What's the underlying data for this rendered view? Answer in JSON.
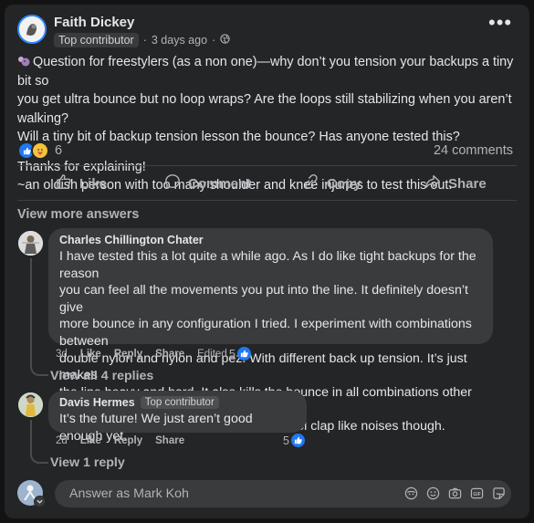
{
  "post": {
    "author": "Faith Dickey",
    "badge": "Top contributor",
    "time": "3 days ago",
    "audience_icon": "globe-icon",
    "menu_label": "•••",
    "body_line1": "Question for freestylers (as a non one)—why don’t you tension your backups a tiny bit so",
    "body_line2": "you get ultra bounce but no loop wraps? Are the loops still stabilizing when you aren’t walking?",
    "body_line3": "Will a tiny bit of backup tension lesson the bounce? Has anyone tested this?",
    "body_line4": "Thanks for explaining!",
    "body_line5": "~an oldish person with too many shoulder and knee injuries to test this out.",
    "reaction_count": "6",
    "comments_count": "24 comments"
  },
  "actions": {
    "like": "Like",
    "comment": "Comment",
    "copy": "Copy",
    "share": "Share"
  },
  "view_more_answers": "View more answers",
  "comments": [
    {
      "author": "Charles Chillington Chater",
      "lines": [
        "I have tested this a lot quite a while ago. As I do like tight backups for the reason",
        "you can feel all the movements you put into the line. It definitely doesn’t give",
        "more bounce in any configuration I tried. I experiment with combinations between",
        "double nylon and nylon and pez. With different back up tension. It’s just makes",
        "the line heavy and hard. It also kills the bounce in all combinations other than",
        "back up same tension as main. Makes cool clap like noises though."
      ],
      "time": "3d",
      "like": "Like",
      "reply": "Reply",
      "share": "Share",
      "edited": "Edited",
      "reaction_count": "5",
      "replies_link": "View all 4 replies"
    },
    {
      "author": "Davis Hermes",
      "badge": "Top contributor",
      "lines": [
        "It’s the future! We just aren’t good enough yet."
      ],
      "time": "2d",
      "like": "Like",
      "reply": "Reply",
      "share": "Share",
      "reaction_count": "5",
      "replies_link": "View 1 reply"
    }
  ],
  "composer": {
    "placeholder": "Answer as Mark Koh"
  },
  "colors": {
    "background": "#131313",
    "card": "#242526",
    "bubble": "#3a3b3c",
    "like_blue": "#2078f4",
    "primary_text": "#e4e6eb",
    "secondary_text": "#b0b3b8"
  }
}
